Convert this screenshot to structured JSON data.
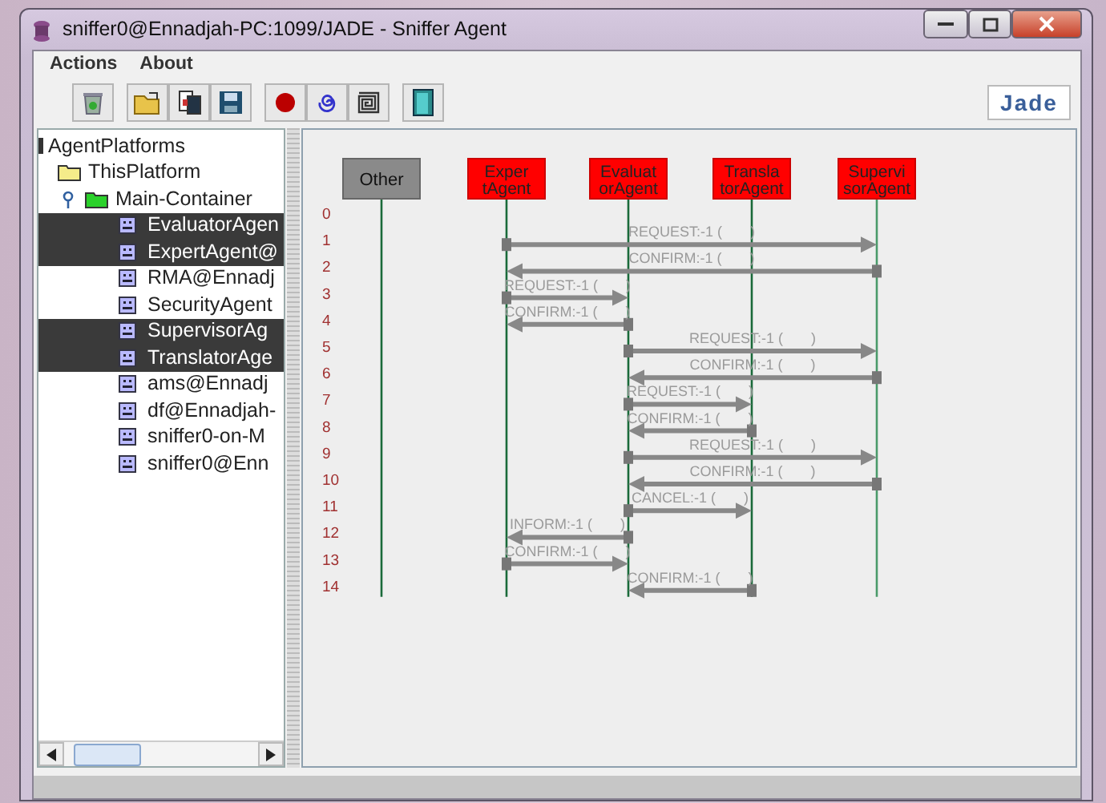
{
  "window": {
    "title": "sniffer0@Ennadjah-PC:1099/JADE - Sniffer Agent"
  },
  "menu": [
    "Actions",
    "About"
  ],
  "logo": "Jade",
  "tree": {
    "label": "AgentPlatforms",
    "children": [
      {
        "label": "ThisPlatform",
        "kind": "platform",
        "children": [
          {
            "label": "Main-Container",
            "kind": "container",
            "expanded": true,
            "children": [
              {
                "label": "EvaluatorAgen",
                "kind": "agent",
                "selected": true
              },
              {
                "label": "ExpertAgent@",
                "kind": "agent",
                "selected": true
              },
              {
                "label": "RMA@Ennadj",
                "kind": "agent",
                "selected": false
              },
              {
                "label": "SecurityAgent",
                "kind": "agent",
                "selected": false
              },
              {
                "label": "SupervisorAg",
                "kind": "agent",
                "selected": true
              },
              {
                "label": "TranslatorAge",
                "kind": "agent",
                "selected": true
              },
              {
                "label": "ams@Ennadj",
                "kind": "agent",
                "selected": false
              },
              {
                "label": "df@Ennadjah-",
                "kind": "agent",
                "selected": false
              },
              {
                "label": "sniffer0-on-M",
                "kind": "agent",
                "selected": false
              },
              {
                "label": "sniffer0@Enn",
                "kind": "agent",
                "selected": false
              }
            ]
          }
        ]
      }
    ]
  },
  "agents": [
    {
      "kind": "other",
      "lines": [
        "Other"
      ]
    },
    {
      "kind": "agent",
      "lines": [
        "Exper",
        "tAgent"
      ]
    },
    {
      "kind": "agent",
      "lines": [
        "Evaluat",
        "orAgent"
      ]
    },
    {
      "kind": "agent",
      "lines": [
        "Transla",
        "torAgent"
      ]
    },
    {
      "kind": "agent",
      "lines": [
        "Supervi",
        "sorAgent"
      ]
    }
  ],
  "rows": [
    {
      "number": "0"
    },
    {
      "number": "1",
      "message": {
        "label": "REQUEST:-1 (       )",
        "lanes": [
          {
            "kind": "none"
          },
          {
            "kind": "source"
          },
          {
            "kind": "none"
          },
          {
            "kind": "none"
          },
          {
            "kind": "target"
          }
        ]
      }
    },
    {
      "number": "2",
      "message": {
        "label": "CONFIRM:-1 (       )",
        "lanes": [
          {
            "kind": "none"
          },
          {
            "kind": "target"
          },
          {
            "kind": "none"
          },
          {
            "kind": "none"
          },
          {
            "kind": "source"
          }
        ]
      }
    },
    {
      "number": "3",
      "message": {
        "label": "REQUEST:-1 (       )",
        "lanes": [
          {
            "kind": "none"
          },
          {
            "kind": "source"
          },
          {
            "kind": "target"
          },
          {
            "kind": "none"
          },
          {
            "kind": "none"
          }
        ]
      }
    },
    {
      "number": "4",
      "message": {
        "label": "CONFIRM:-1 (       )",
        "lanes": [
          {
            "kind": "none"
          },
          {
            "kind": "target"
          },
          {
            "kind": "source"
          },
          {
            "kind": "none"
          },
          {
            "kind": "none"
          }
        ]
      }
    },
    {
      "number": "5",
      "message": {
        "label": "REQUEST:-1 (       )",
        "lanes": [
          {
            "kind": "none"
          },
          {
            "kind": "none"
          },
          {
            "kind": "source"
          },
          {
            "kind": "none"
          },
          {
            "kind": "target"
          }
        ]
      }
    },
    {
      "number": "6",
      "message": {
        "label": "CONFIRM:-1 (       )",
        "lanes": [
          {
            "kind": "none"
          },
          {
            "kind": "none"
          },
          {
            "kind": "target"
          },
          {
            "kind": "none"
          },
          {
            "kind": "source"
          }
        ]
      }
    },
    {
      "number": "7",
      "message": {
        "label": "REQUEST:-1 (       )",
        "lanes": [
          {
            "kind": "none"
          },
          {
            "kind": "none"
          },
          {
            "kind": "source"
          },
          {
            "kind": "target"
          },
          {
            "kind": "none"
          }
        ]
      }
    },
    {
      "number": "8",
      "message": {
        "label": "CONFIRM:-1 (       )",
        "lanes": [
          {
            "kind": "none"
          },
          {
            "kind": "none"
          },
          {
            "kind": "target"
          },
          {
            "kind": "source"
          },
          {
            "kind": "none"
          }
        ]
      }
    },
    {
      "number": "9",
      "message": {
        "label": "REQUEST:-1 (       )",
        "lanes": [
          {
            "kind": "none"
          },
          {
            "kind": "none"
          },
          {
            "kind": "source"
          },
          {
            "kind": "none"
          },
          {
            "kind": "target"
          }
        ]
      }
    },
    {
      "number": "10",
      "message": {
        "label": "CONFIRM:-1 (       )",
        "lanes": [
          {
            "kind": "none"
          },
          {
            "kind": "none"
          },
          {
            "kind": "target"
          },
          {
            "kind": "none"
          },
          {
            "kind": "source"
          }
        ]
      }
    },
    {
      "number": "11",
      "message": {
        "label": "CANCEL:-1 (       )",
        "lanes": [
          {
            "kind": "none"
          },
          {
            "kind": "none"
          },
          {
            "kind": "source"
          },
          {
            "kind": "target"
          },
          {
            "kind": "none"
          }
        ]
      }
    },
    {
      "number": "12",
      "message": {
        "label": "INFORM:-1 (       )",
        "lanes": [
          {
            "kind": "none"
          },
          {
            "kind": "target"
          },
          {
            "kind": "source"
          },
          {
            "kind": "none"
          },
          {
            "kind": "none"
          }
        ]
      }
    },
    {
      "number": "13",
      "message": {
        "label": "CONFIRM:-1 (       )",
        "lanes": [
          {
            "kind": "none"
          },
          {
            "kind": "source"
          },
          {
            "kind": "target"
          },
          {
            "kind": "none"
          },
          {
            "kind": "none"
          }
        ]
      }
    },
    {
      "number": "14",
      "message": {
        "label": "CONFIRM:-1 (       )",
        "lanes": [
          {
            "kind": "none"
          },
          {
            "kind": "none"
          },
          {
            "kind": "target"
          },
          {
            "kind": "source"
          },
          {
            "kind": "none"
          }
        ]
      }
    }
  ]
}
